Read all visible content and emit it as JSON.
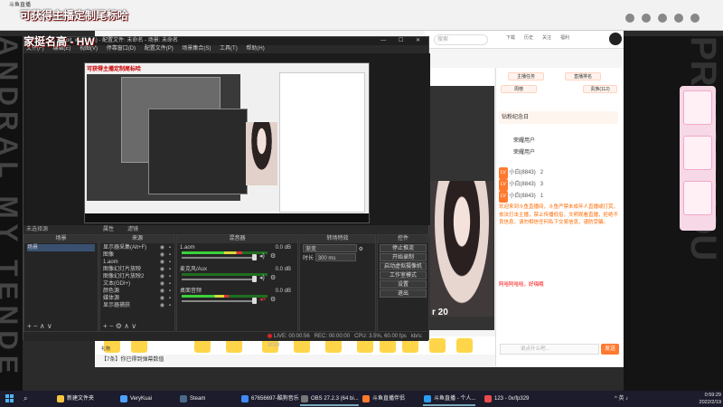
{
  "browser": {
    "tab_label": "斗鱼直播",
    "url": "https://www.douyu.com/10628765",
    "overlay_title": "可获得主播定制尾标哈"
  },
  "douyu": {
    "search_placeholder": "搜索",
    "header_icons": [
      "下载",
      "历史",
      "关注",
      "福利"
    ],
    "stream_overlay_text": "r 20",
    "chat": {
      "tab_labels": [
        "主播任务",
        "直播排名",
        "周榜",
        "贵族(112)"
      ],
      "gift_header": "周榜",
      "fans_title": "钻粉纪念日",
      "fans_names": [
        "荣耀用户",
        "荣耀用户"
      ],
      "rank_rows": [
        {
          "label": "小白(8843)",
          "value": "2"
        },
        {
          "label": "小白(8843)",
          "value": "3"
        },
        {
          "label": "小白(8843)",
          "value": "1"
        }
      ],
      "welcome": "欢迎来到斗鱼直播间，斗鱼严禁未成年人直播或打赏，依法打击主播，禁止传播低俗，文明观看直播，拒绝不良信息，请勿相信任何私下交易信息，谨防受骗。",
      "last_msg": "阿哈阿哈哈，好嗨哦",
      "input_placeholder": "说点什么吧...",
      "send_label": "发送"
    },
    "bottom_notice": "【7条】你已得到弹幕数值",
    "gift_label": "礼物"
  },
  "obs": {
    "title": "OBS 27.2.3 (64 bit, windows) - 配置文件: 未命名 - 场景: 未命名",
    "overlay_title": "家挺名高 - HW",
    "window_controls": "— ☐ ✕",
    "menu": [
      "文件(F)",
      "编辑(E)",
      "视图(V)",
      "停靠窗口(D)",
      "配置文件(P)",
      "场景集合(S)",
      "工具(T)",
      "帮助(H)"
    ],
    "preview_inner_title": "可获得主播定制尾标哈",
    "status_left": "未选择源",
    "status_props": "属性",
    "status_filters": "滤镜",
    "scenes": {
      "title": "场景",
      "items": [
        "场景"
      ]
    },
    "sources": {
      "title": "来源",
      "items": [
        "显示器采集(Alt+F)",
        "图像",
        "1.aom",
        "图像幻灯片放映",
        "图像幻灯片放映2",
        "文本(GDI+)",
        "颜色源",
        "媒体源",
        "显示器捕获"
      ]
    },
    "mixer": {
      "title": "混音器",
      "channels": [
        {
          "name": "1.aom",
          "db": "0.0 dB",
          "level": 0.7,
          "muted": false
        },
        {
          "name": "麦克风/Aux",
          "db": "0.0 dB",
          "level": 0.0,
          "muted": false
        },
        {
          "name": "桌面音频",
          "db": "0.0 dB",
          "level": 0.55,
          "muted": true
        }
      ]
    },
    "transitions": {
      "title": "转场特效",
      "type": "渐变",
      "duration_label": "时长",
      "duration": "300 ms"
    },
    "controls": {
      "title": "控件",
      "buttons": [
        "停止推流",
        "开始录制",
        "启动虚拟摄像机",
        "工作室模式",
        "设置",
        "退出"
      ]
    },
    "footer": {
      "live": "LIVE: 00:00:56",
      "rec": "REC: 00:00:00",
      "cpu": "CPU: 3.5%, 60.00 fps",
      "kbps": "kb/s: 3019"
    }
  },
  "taskbar": {
    "items": [
      {
        "label": "新建文件夹",
        "color": "#f5c542"
      },
      {
        "label": "VeryKuai",
        "color": "#4ea1ff"
      },
      {
        "label": "Steam",
        "color": "#1b2838"
      },
      {
        "label": "67656697-酷狗音乐",
        "color": "#3d8bfd"
      },
      {
        "label": "OBS 27.2.3 (64 bi...",
        "color": "#555555"
      },
      {
        "label": "斗鱼直播伴侣",
        "color": "#ff7a2f"
      },
      {
        "label": "斗鱼直播 - 个人...",
        "color": "#2a9df4"
      },
      {
        "label": "123 - 0x/fp329",
        "color": "#e94c4c"
      }
    ],
    "tray": "^ 英 ♪",
    "time": "0:59:29",
    "date": "2022/2/19"
  },
  "side_banner_left": "ANDRAL MY TENDE",
  "side_banner_right": "PRINCE YOU"
}
